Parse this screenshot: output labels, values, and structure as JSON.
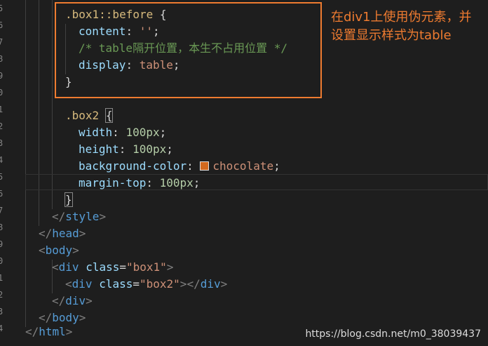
{
  "gutter": {
    "line_numbers": [
      "5",
      "6",
      "7",
      "8",
      "9",
      "0",
      "1",
      "2",
      "3",
      "4",
      "5",
      "6",
      "7",
      "8",
      "9",
      "0",
      "1",
      "2",
      "3",
      "4"
    ]
  },
  "code": {
    "l1": {
      "sel": ".box1::before",
      "rest": " {"
    },
    "l2": {
      "prop": "content",
      "colon": ": ",
      "val": "''",
      "semi": ";"
    },
    "l3": {
      "comment": "/* table隔开位置，本生不占用位置 */"
    },
    "l4": {
      "prop": "display",
      "colon": ": ",
      "val": "table",
      "semi": ";"
    },
    "l5": {
      "brace": "}"
    },
    "l7": {
      "sel": ".box2",
      "sp": " ",
      "brace": "{"
    },
    "l8": {
      "prop": "width",
      "colon": ": ",
      "val": "100px",
      "semi": ";"
    },
    "l9": {
      "prop": "height",
      "colon": ": ",
      "val": "100px",
      "semi": ";"
    },
    "l10": {
      "prop": "background-color",
      "colon": ": ",
      "val": "chocolate",
      "semi": ";"
    },
    "l11": {
      "prop": "margin-top",
      "colon": ": ",
      "val": "100px",
      "semi": ";"
    },
    "l12": {
      "brace": "}"
    },
    "l13": {
      "open": "</",
      "tag": "style",
      "close": ">"
    },
    "l14": {
      "open": "</",
      "tag": "head",
      "close": ">"
    },
    "l15": {
      "open": "<",
      "tag": "body",
      "close": ">"
    },
    "l16": {
      "open": "<",
      "tag": "div",
      "sp": " ",
      "attr": "class",
      "eq": "=",
      "val": "\"box1\"",
      "close": ">"
    },
    "l17": {
      "open": "<",
      "tag": "div",
      "sp": " ",
      "attr": "class",
      "eq": "=",
      "val": "\"box2\"",
      "close": ">",
      "open2": "</",
      "tag2": "div",
      "close2": ">"
    },
    "l18": {
      "open": "</",
      "tag": "div",
      "close": ">"
    },
    "l19": {
      "open": "</",
      "tag": "body",
      "close": ">"
    },
    "l20": {
      "open": "</",
      "tag": "html",
      "close": ">"
    }
  },
  "annotation": {
    "line1": "在div1上使用伪元素，并",
    "line2": "设置显示样式为table"
  },
  "watermark": "https://blog.csdn.net/m0_38039437",
  "colors": {
    "annotation": "#ee7b30",
    "swatch": "#d2691e",
    "background": "#1e1e1e"
  }
}
